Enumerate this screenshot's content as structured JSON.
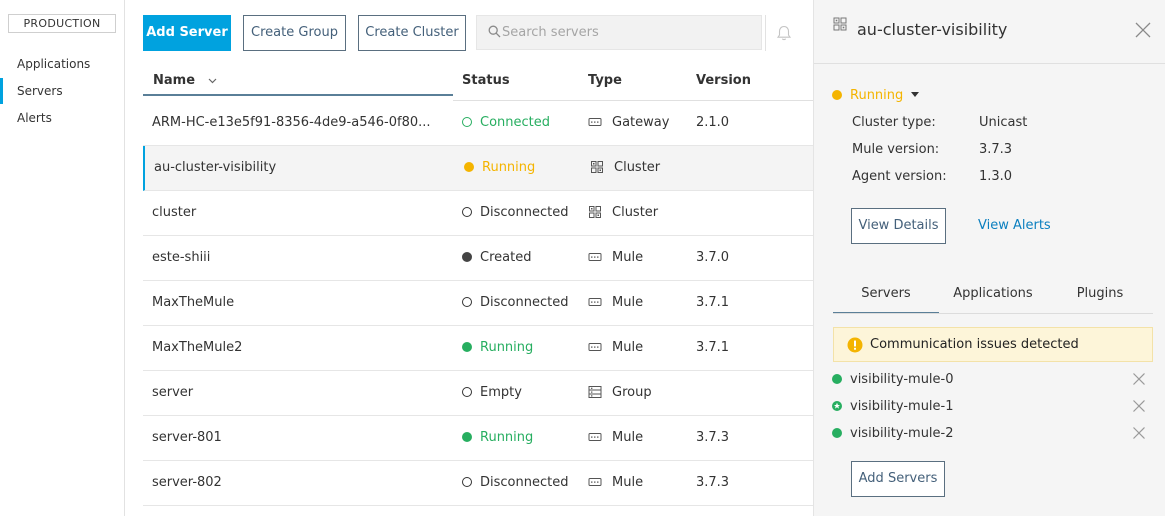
{
  "sidebar": {
    "environment": "PRODUCTION",
    "items": [
      {
        "label": "Applications",
        "active": false
      },
      {
        "label": "Servers",
        "active": true
      },
      {
        "label": "Alerts",
        "active": false
      }
    ]
  },
  "toolbar": {
    "add_server": "Add Server",
    "create_group": "Create Group",
    "create_cluster": "Create Cluster",
    "search_placeholder": "Search servers",
    "icons": {
      "search": "search-icon",
      "notifications": "bell-icon"
    }
  },
  "table": {
    "columns": {
      "name": "Name",
      "status": "Status",
      "type": "Type",
      "version": "Version"
    },
    "rows": [
      {
        "name": "ARM-HC-e13e5f91-8356-4de9-a546-0f80...",
        "status": "Connected",
        "type": "Gateway",
        "version": "2.1.0"
      },
      {
        "name": "au-cluster-visibility",
        "status": "Running",
        "type": "Cluster",
        "version": ""
      },
      {
        "name": "cluster",
        "status": "Disconnected",
        "type": "Cluster",
        "version": ""
      },
      {
        "name": "este-shiii",
        "status": "Created",
        "type": "Mule",
        "version": "3.7.0"
      },
      {
        "name": "MaxTheMule",
        "status": "Disconnected",
        "type": "Mule",
        "version": "3.7.1"
      },
      {
        "name": "MaxTheMule2",
        "status": "Running",
        "type": "Mule",
        "version": "3.7.1"
      },
      {
        "name": "server",
        "status": "Empty",
        "type": "Group",
        "version": ""
      },
      {
        "name": "server-801",
        "status": "Running",
        "type": "Mule",
        "version": "3.7.3"
      },
      {
        "name": "server-802",
        "status": "Disconnected",
        "type": "Mule",
        "version": "3.7.3"
      }
    ]
  },
  "panel": {
    "title": "au-cluster-visibility",
    "status": "Running",
    "properties": [
      {
        "label": "Cluster type:",
        "value": "Unicast"
      },
      {
        "label": "Mule version:",
        "value": "3.7.3"
      },
      {
        "label": "Agent version:",
        "value": "1.3.0"
      }
    ],
    "view_details": "View Details",
    "view_alerts": "View Alerts",
    "tabs": [
      "Servers",
      "Applications",
      "Plugins"
    ],
    "alert": "Communication issues detected",
    "servers": [
      "visibility-mule-0",
      "visibility-mule-1",
      "visibility-mule-2"
    ],
    "add_servers": "Add Servers"
  },
  "colors": {
    "accent": "#00a2df",
    "running": "#f4b400",
    "connected": "#27ae60",
    "created": "#444444",
    "link": "#0b7fbf"
  }
}
